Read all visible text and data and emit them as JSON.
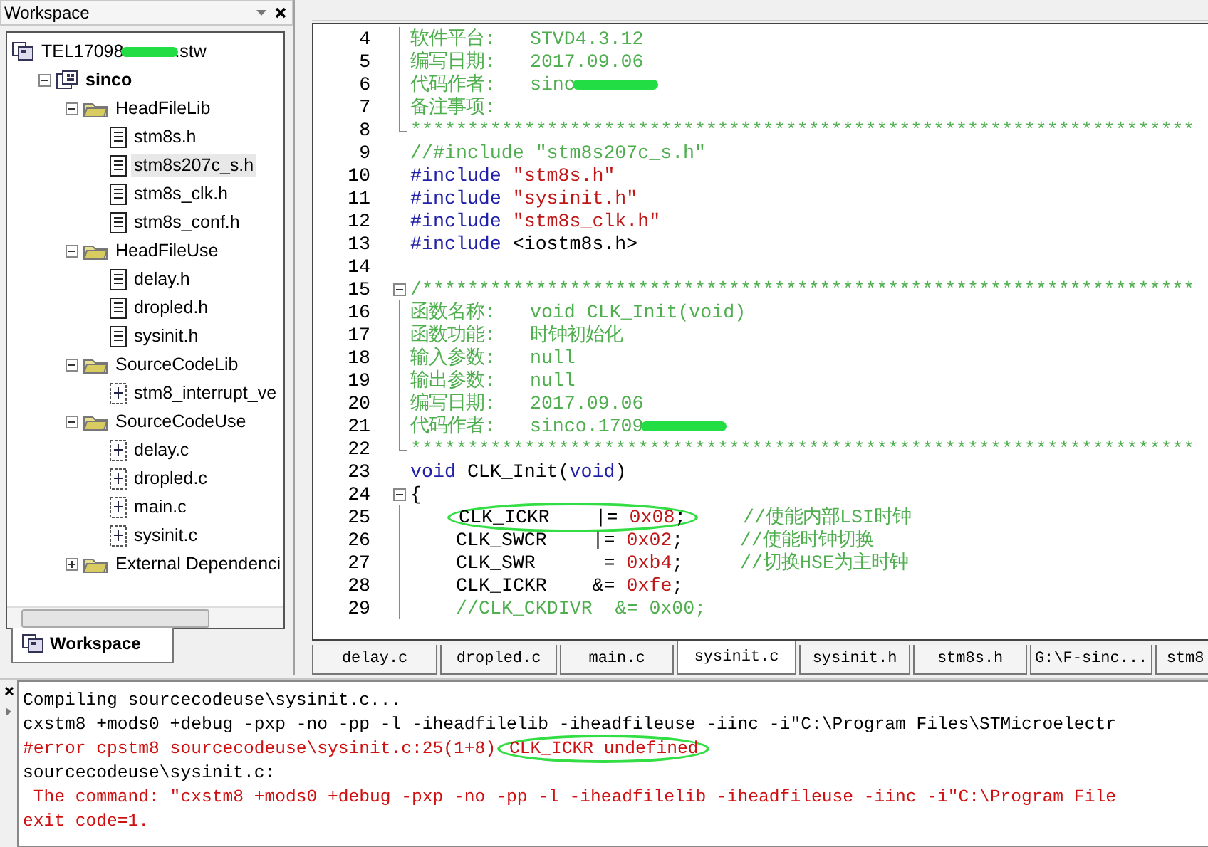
{
  "workspace_panel": {
    "title": "Workspace",
    "tab": {
      "label": "Workspace",
      "selected": true
    },
    "tree": [
      {
        "kind": "workspace",
        "label": "TEL17098",
        "redacted": true,
        "suffix": ".stw",
        "selected": false,
        "children": [
          {
            "kind": "project",
            "label": "sinco",
            "selected": false,
            "expanded": true,
            "children": [
              {
                "kind": "folder",
                "label": "HeadFileLib",
                "selected": false,
                "expanded": true,
                "children": [
                  {
                    "kind": "header",
                    "label": "stm8s.h",
                    "selected": false
                  },
                  {
                    "kind": "header",
                    "label": "stm8s207c_s.h",
                    "selected": true
                  },
                  {
                    "kind": "header",
                    "label": "stm8s_clk.h",
                    "selected": false
                  },
                  {
                    "kind": "header",
                    "label": "stm8s_conf.h",
                    "selected": false
                  }
                ]
              },
              {
                "kind": "folder",
                "label": "HeadFileUse",
                "selected": false,
                "expanded": true,
                "children": [
                  {
                    "kind": "header",
                    "label": "delay.h",
                    "selected": false
                  },
                  {
                    "kind": "header",
                    "label": "dropled.h",
                    "selected": false
                  },
                  {
                    "kind": "header",
                    "label": "sysinit.h",
                    "selected": false
                  }
                ]
              },
              {
                "kind": "folder",
                "label": "SourceCodeLib",
                "selected": false,
                "expanded": true,
                "children": [
                  {
                    "kind": "source",
                    "label": "stm8_interrupt_ve",
                    "selected": false
                  }
                ]
              },
              {
                "kind": "folder",
                "label": "SourceCodeUse",
                "selected": false,
                "expanded": true,
                "children": [
                  {
                    "kind": "source",
                    "label": "delay.c",
                    "selected": false
                  },
                  {
                    "kind": "source",
                    "label": "dropled.c",
                    "selected": false
                  },
                  {
                    "kind": "source",
                    "label": "main.c",
                    "selected": false
                  },
                  {
                    "kind": "source",
                    "label": "sysinit.c",
                    "selected": false
                  }
                ]
              },
              {
                "kind": "folder",
                "label": "External Dependenci",
                "selected": false,
                "expanded": false
              }
            ]
          }
        ]
      }
    ]
  },
  "editor": {
    "lines": [
      {
        "number": "4",
        "fold_line": true,
        "segments": [
          {
            "kind": "comment",
            "text": "软件平台:   STVD4.3.12"
          }
        ]
      },
      {
        "number": "5",
        "fold_line": true,
        "segments": [
          {
            "kind": "comment",
            "text": "编写日期:   2017.09.06"
          }
        ]
      },
      {
        "number": "6",
        "fold_line": true,
        "segments": [
          {
            "kind": "comment",
            "text": "代码作者:   sinc",
            "redacted": true
          }
        ]
      },
      {
        "number": "7",
        "fold_line": true,
        "segments": [
          {
            "kind": "comment",
            "text": "备注事项:"
          }
        ]
      },
      {
        "number": "8",
        "fold_end": true,
        "segments": [
          {
            "kind": "comment",
            "text": "*********************************************************************"
          }
        ]
      },
      {
        "number": "9",
        "segments": [
          {
            "kind": "comment",
            "text": "//#include \"stm8s207c_s.h\""
          }
        ]
      },
      {
        "number": "10",
        "segments": [
          {
            "kind": "keyword",
            "text": "#include"
          },
          {
            "kind": "string",
            "text": " \"stm8s.h\""
          }
        ]
      },
      {
        "number": "11",
        "segments": [
          {
            "kind": "keyword",
            "text": "#include"
          },
          {
            "kind": "string",
            "text": " \"sysinit.h\""
          }
        ]
      },
      {
        "number": "12",
        "segments": [
          {
            "kind": "keyword",
            "text": "#include"
          },
          {
            "kind": "string",
            "text": " \"stm8s_clk.h\""
          }
        ]
      },
      {
        "number": "13",
        "segments": [
          {
            "kind": "keyword",
            "text": "#include"
          },
          {
            "kind": "text",
            "text": " <iostm8s.h>"
          }
        ]
      },
      {
        "number": "14"
      },
      {
        "number": "15",
        "fold_box": true,
        "segments": [
          {
            "kind": "comment",
            "text": "/********************************************************************"
          }
        ]
      },
      {
        "number": "16",
        "fold_line": true,
        "segments": [
          {
            "kind": "comment",
            "text": "函数名称:   void CLK_Init(void)"
          }
        ]
      },
      {
        "number": "17",
        "fold_line": true,
        "segments": [
          {
            "kind": "comment",
            "text": "函数功能:   时钟初始化"
          }
        ]
      },
      {
        "number": "18",
        "fold_line": true,
        "segments": [
          {
            "kind": "comment",
            "text": "输入参数:   null"
          }
        ]
      },
      {
        "number": "19",
        "fold_line": true,
        "segments": [
          {
            "kind": "comment",
            "text": "输出参数:   null"
          }
        ]
      },
      {
        "number": "20",
        "fold_line": true,
        "segments": [
          {
            "kind": "comment",
            "text": "编写日期:   2017.09.06"
          }
        ]
      },
      {
        "number": "21",
        "fold_line": true,
        "segments": [
          {
            "kind": "comment",
            "text": "代码作者:   sinco.1709",
            "redacted": true
          }
        ]
      },
      {
        "number": "22",
        "fold_end": true,
        "segments": [
          {
            "kind": "comment",
            "text": "*********************************************************************"
          }
        ]
      },
      {
        "number": "23",
        "segments": [
          {
            "kind": "keyword",
            "text": "void"
          },
          {
            "kind": "text",
            "text": " CLK_Init("
          },
          {
            "kind": "keyword",
            "text": "void"
          },
          {
            "kind": "text",
            "text": ")"
          }
        ]
      },
      {
        "number": "24",
        "fold_box": true,
        "segments": [
          {
            "kind": "text",
            "text": "{"
          }
        ]
      },
      {
        "number": "25",
        "fold_line": true,
        "indent": true,
        "segments": [
          {
            "kind": "text",
            "text": "CLK_ICKR    |= ",
            "circled": true
          },
          {
            "kind": "number",
            "text": "0x08",
            "circled": true
          },
          {
            "kind": "text",
            "text": ";",
            "circled": true
          },
          {
            "kind": "comment",
            "text": "     //使能内部LSI时钟"
          }
        ]
      },
      {
        "number": "26",
        "fold_line": true,
        "indent": true,
        "segments": [
          {
            "kind": "text",
            "text": "CLK_SWCR    |= "
          },
          {
            "kind": "number",
            "text": "0x02"
          },
          {
            "kind": "text",
            "text": ";"
          },
          {
            "kind": "comment",
            "text": "     //使能时钟切换"
          }
        ]
      },
      {
        "number": "27",
        "fold_line": true,
        "indent": true,
        "segments": [
          {
            "kind": "text",
            "text": "CLK_SWR      = "
          },
          {
            "kind": "number",
            "text": "0xb4"
          },
          {
            "kind": "text",
            "text": ";"
          },
          {
            "kind": "comment",
            "text": "     //切换HSE为主时钟"
          }
        ]
      },
      {
        "number": "28",
        "fold_line": true,
        "indent": true,
        "segments": [
          {
            "kind": "text",
            "text": "CLK_ICKR    &= "
          },
          {
            "kind": "number",
            "text": "0xfe"
          },
          {
            "kind": "text",
            "text": ";"
          }
        ]
      },
      {
        "number": "29",
        "fold_line": true,
        "indent": true,
        "segments": [
          {
            "kind": "comment",
            "text": "//CLK_CKDIVR  &= 0x00;"
          }
        ]
      }
    ],
    "tabs": [
      {
        "label": "delay.c",
        "selected": false
      },
      {
        "label": "dropled.c",
        "selected": false
      },
      {
        "label": "main.c",
        "selected": false
      },
      {
        "label": "sysinit.c",
        "selected": true
      },
      {
        "label": "sysinit.h",
        "selected": false
      },
      {
        "label": "stm8s.h",
        "selected": false
      },
      {
        "label": "G:\\F-sinc...",
        "selected": false
      },
      {
        "label": "stm8",
        "selected": false
      }
    ]
  },
  "output": {
    "lines": [
      {
        "kind": "normal",
        "segments": [
          {
            "text": "Compiling sourcecodeuse\\sysinit.c..."
          }
        ]
      },
      {
        "kind": "normal",
        "segments": [
          {
            "text": "cxstm8 +mods0 +debug -pxp -no -pp -l -iheadfilelib -iheadfileuse -iinc -i\"C:\\Program Files\\STMicroelectr"
          }
        ]
      },
      {
        "kind": "error",
        "segments": [
          {
            "text": "#error cpstm8 sourcecodeuse\\sysinit.c:25(1+8) "
          },
          {
            "text": "CLK_ICKR undefined",
            "circled": true
          }
        ]
      },
      {
        "kind": "normal",
        "segments": [
          {
            "text": "sourcecodeuse\\sysinit.c:"
          }
        ]
      },
      {
        "kind": "error",
        "segments": [
          {
            "text": " The command: \"cxstm8 +mods0 +debug -pxp -no -pp -l -iheadfilelib -iheadfileuse -iinc -i\"C:\\Program File"
          }
        ]
      },
      {
        "kind": "error",
        "segments": [
          {
            "text": "exit code=1."
          }
        ]
      }
    ]
  }
}
